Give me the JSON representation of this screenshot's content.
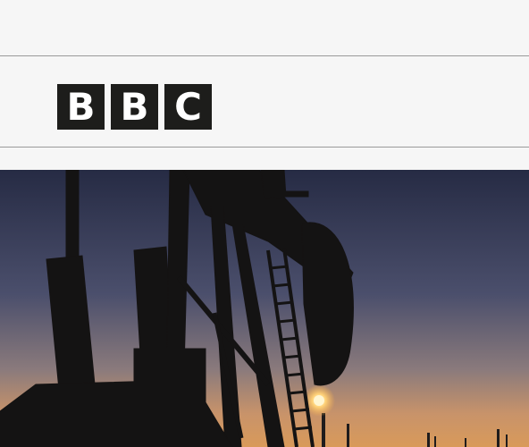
{
  "logo": {
    "letters": [
      "B",
      "B",
      "C"
    ]
  },
  "hero": {
    "description": "",
    "colors": {
      "sky_top": "#2a2f4a",
      "sky_mid": "#4a4f6d",
      "horizon": "#c48a5c",
      "glow": "#f6c98a",
      "silhouette": "#161514",
      "flare": "#fff3c8"
    }
  }
}
